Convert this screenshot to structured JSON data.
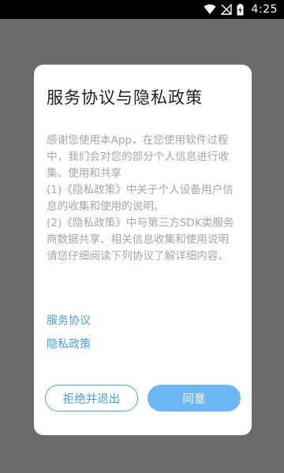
{
  "status_bar": {
    "time": "4:25",
    "icons": [
      "wifi-icon",
      "no-signal-icon",
      "battery-charging-icon"
    ]
  },
  "dialog": {
    "title": "服务协议与隐私政策",
    "paragraphs": [
      "感谢您使用本App，在您使用软件过程中，我们会对您的部分个人信息进行收集、使用和共享",
      "(1)《隐私政策》中关于个人设备用户信息的收集和使用的说明。",
      "(2)《隐私政策》中与第三方SDK类服务商数据共享、相关信息收集和使用说明",
      "请您仔细阅读下列协议了解详细内容。"
    ],
    "links": {
      "service_agreement": "服务协议",
      "privacy_policy": "隐私政策"
    },
    "buttons": {
      "reject": "拒绝并退出",
      "agree": "同意"
    }
  },
  "colors": {
    "backdrop": "#6b6b6b",
    "accent": "#4a9fe0",
    "agree_button": "#6eb7f5",
    "body_text": "#a6a6a6"
  }
}
